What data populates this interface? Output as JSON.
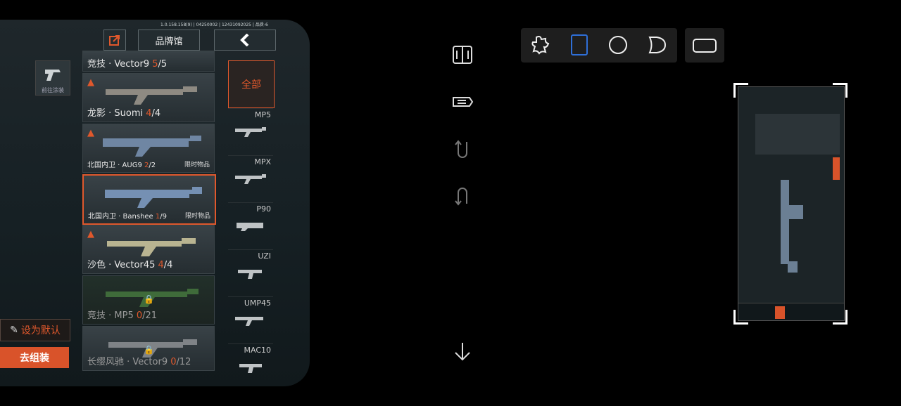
{
  "game": {
    "build_info": "1.0.158.158(9) | 04250002 | 12431092025 | 品质-6",
    "brand_hall_label": "品牌馆",
    "paint_label": "前往涂装",
    "set_default_label": "设为默认",
    "assemble_label": "去组装",
    "skins": [
      {
        "name": "竞技 · Vector9 ",
        "count": "5",
        "total": "/5",
        "tag": "",
        "hot": false,
        "locked": false,
        "small": false
      },
      {
        "name": "龙影 · Suomi ",
        "count": "4",
        "total": "/4",
        "tag": "",
        "hot": true,
        "locked": false,
        "small": false
      },
      {
        "name": "北国内卫 · AUG9 ",
        "count": "2",
        "total": "/2",
        "tag": "限时物品",
        "hot": true,
        "locked": false,
        "small": true
      },
      {
        "name": "北国内卫 · Banshee ",
        "count": "1",
        "total": "/9",
        "tag": "限时物品",
        "hot": false,
        "locked": false,
        "small": true
      },
      {
        "name": "沙色 · Vector45 ",
        "count": "4",
        "total": "/4",
        "tag": "",
        "hot": true,
        "locked": false,
        "small": false
      },
      {
        "name": "竞技 · MP5 ",
        "count": "0",
        "total": "/21",
        "tag": "",
        "hot": false,
        "locked": true,
        "small": false
      },
      {
        "name": "长缨风驰 · Vector9 ",
        "count": "0",
        "total": "/12",
        "tag": "",
        "hot": false,
        "locked": true,
        "small": false
      }
    ],
    "categories": {
      "all": "全部",
      "items": [
        "MP5",
        "MPX",
        "P90",
        "UZI",
        "UMP45",
        "MAC10"
      ]
    }
  },
  "toolbar": {
    "side_tools": [
      "split-view-icon",
      "tag-icon",
      "rotate-down-icon",
      "rotate-up-icon"
    ],
    "bottom_tool": "arrow-down-icon",
    "shapes": [
      "puzzle-icon",
      "rectangle-icon",
      "circle-icon",
      "heart-icon"
    ],
    "selected_shape": "rectangle-icon",
    "extra_shape": "rounded-rect-icon",
    "accent_color": "#2f6fd8"
  },
  "colors": {
    "accent_orange": "#e0582c"
  }
}
